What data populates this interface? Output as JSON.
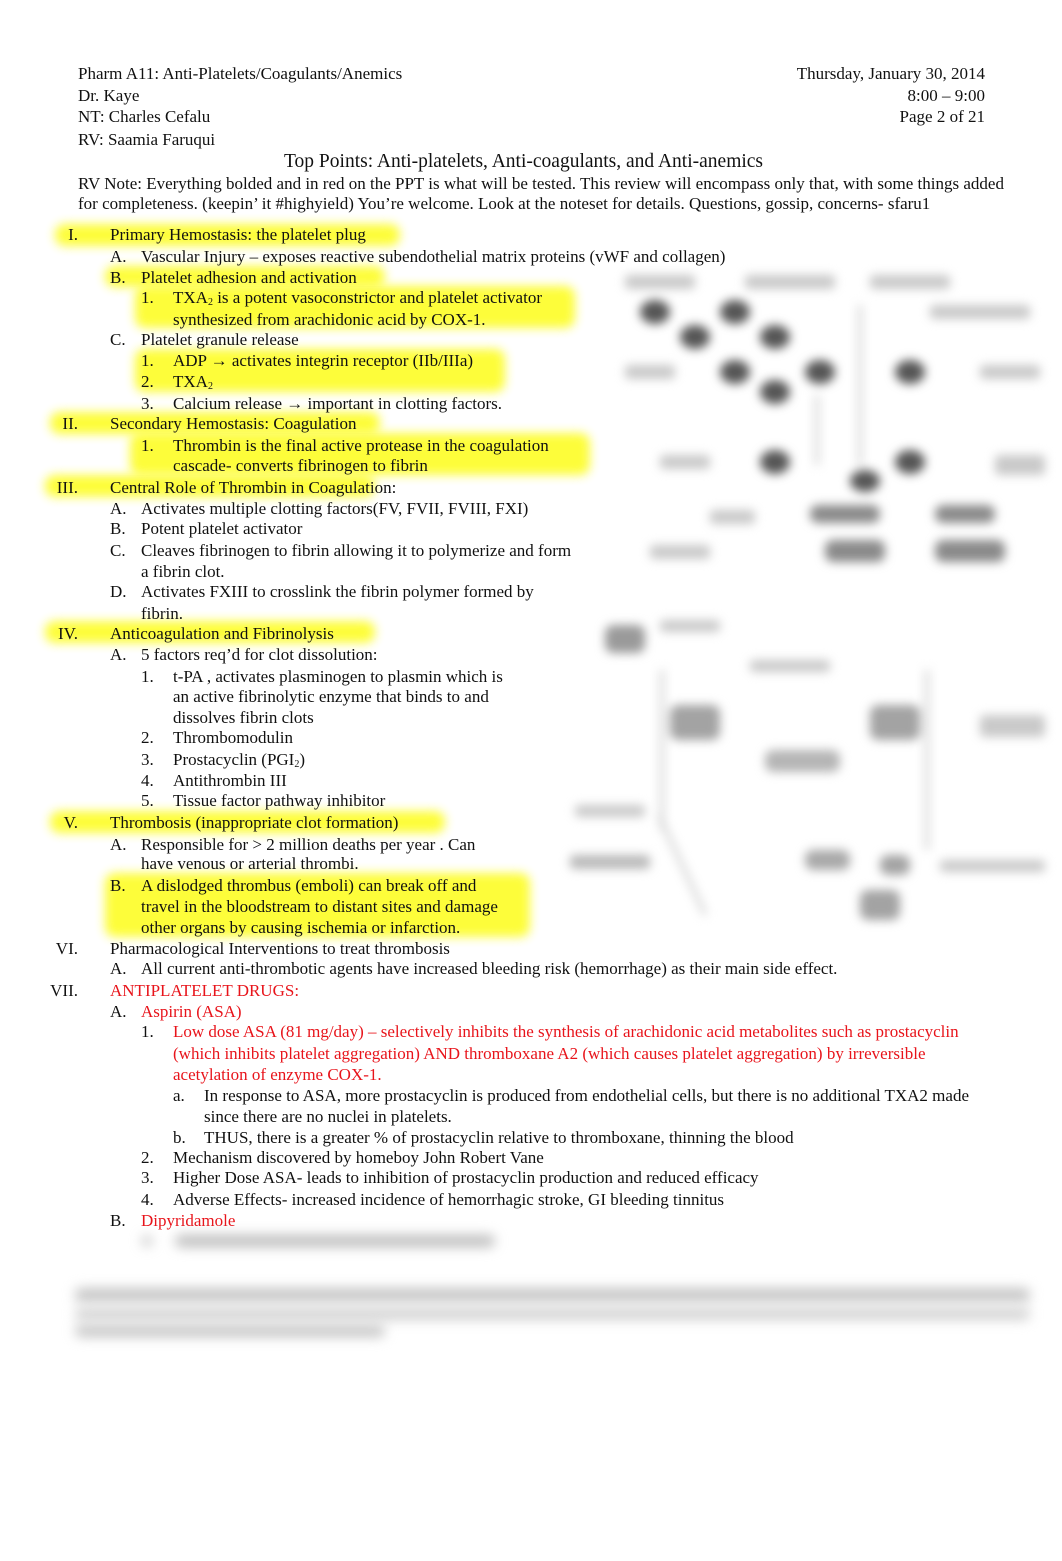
{
  "header": {
    "course": "Pharm A11: Anti-Platelets/Coagulants/Anemics",
    "lecturer": "Dr. Kaye",
    "note_taker": "NT:  Charles Cefalu",
    "reviewer": "RV:  Saamia Faruqui",
    "date": "Thursday, January 30, 2014",
    "time": "8:00 – 9:00",
    "page": "Page 2 of 21"
  },
  "title": "Top Points: Anti-platelets, Anti-coagulants, and Anti-anemics",
  "rv_note": {
    "line1": "RV Note: Everything bolded and in red on the PPT is what will be tested. This review will encompass only that, with some things added",
    "line2": "for completeness. (keepin’ it #highyield) You’re welcome. Look at the noteset for details. Questions, gossip, concerns- sfaru1"
  },
  "highlight_color": "#ffff00",
  "red_color": "#e8141b",
  "outline": {
    "s1": {
      "num": "I.",
      "text": "Primary Hemostasis:    the platelet plug",
      "a": {
        "num": "A.",
        "text": " Vascular Injury   – exposes reactive subendothelial matrix proteins (vWF and collagen)"
      },
      "b": {
        "num": "B.",
        "text": "Platelet adhesion and activation",
        "i1": {
          "num": "1.",
          "pre": "TXA",
          "sub": "2",
          "post": " is a potent vasoconstrictor and platelet activator",
          "line2": "synthesized from arachidonic acid by COX-1."
        }
      },
      "c": {
        "num": "C.",
        "text": "Platelet granule release",
        "i1": {
          "num": "1.",
          "text": "ADP → activates integrin receptor (IIb/IIIa)"
        },
        "i2": {
          "num": "2.",
          "pre": "TXA",
          "sub": "2"
        },
        "i3": {
          "num": "3.",
          "text": "Calcium release → important in clotting factors."
        }
      }
    },
    "s2": {
      "num": "II.",
      "text": "Secondary Hemostasis: Coagulation",
      "i1": {
        "num": "1.",
        "line1": "Thrombin is the final active protease in the coagulation",
        "line2": "cascade- converts fibrinogen to fibrin"
      }
    },
    "s3": {
      "num": "III.",
      "text": "Central Role of Thrombin  in Coagulation:",
      "a": {
        "num": "A.",
        "text": "Activates multiple clotting factors(FV, FVII, FVIII, FXI)"
      },
      "b": {
        "num": "B.",
        "text": "Potent platelet activator"
      },
      "c": {
        "num": "C.",
        "line1": "Cleaves fibrinogen to fibrin allowing it to polymerize and form",
        "line2": "a fibrin clot."
      },
      "d": {
        "num": "D.",
        "line1": "Activates FXIII to crosslink the fibrin polymer formed by",
        "line2": "fibrin."
      }
    },
    "s4": {
      "num": "IV.",
      "text": "Anticoagulation and Fibrinolysis",
      "a": {
        "num": "A.",
        "text": "5 factors req’d for clot dissolution:",
        "i1": {
          "num": "1.",
          "line1": "t-PA , activates plasminogen to plasmin which is",
          "line2": "an active fibrinolytic enzyme that binds to and",
          "line3": "dissolves fibrin clots"
        },
        "i2": {
          "num": "2.",
          "text": "Thrombomodulin"
        },
        "i3": {
          "num": "3.",
          "pre": "Prostacyclin (PGI",
          "sub": "2",
          "post": ")"
        },
        "i4": {
          "num": "4.",
          "text": "Antithrombin III"
        },
        "i5": {
          "num": "5.",
          "text": "Tissue factor pathway inhibitor"
        }
      }
    },
    "s5": {
      "num": "V.",
      "text": "Thrombosis (inappropriate clot formation)",
      "a": {
        "num": "A.",
        "line1": "Responsible for > 2 million deaths per year . Can",
        "line2": "have venous or arterial thrombi."
      },
      "b": {
        "num": "B.",
        "line1": "A dislodged thrombus (emboli) can break off and",
        "line2": "travel in the bloodstream to distant sites and damage",
        "line3": "other organs by causing ischemia or infarction."
      }
    },
    "s6": {
      "num": "VI.",
      "text": "Pharmacological Interventions     to treat thrombosis",
      "a": {
        "num": "A.",
        "text": "All current anti-thrombotic agents have increased bleeding risk    (hemorrhage) as their main side effect."
      }
    },
    "s7": {
      "num": "VII.",
      "text": "ANTIPLATELET DRUGS:",
      "a": {
        "num": "A.",
        "text": "Aspirin (ASA)",
        "i1": {
          "num": "1.",
          "line1": "Low dose ASA (81 mg/day) – selectively inhibits the synthesis of arachidonic acid    metabolites such as prostacyclin",
          "line2": "(which inhibits platelet aggregation) AND thromboxane A2  (which causes platelet aggregation) by irreversible",
          "line3": "acetylation of enzyme COX-1.",
          "ia": {
            "num": "a.",
            "line1": "In response to ASA, more prostacyclin is produced from endothelial cells, but there is no additional TXA2 made",
            "line2": "since there are no nuclei in platelets."
          },
          "ib": {
            "num": "b.",
            "text": "THUS, there is a greater % of prostacyclin relative to thromboxane, thinning the blood"
          }
        },
        "i2": {
          "num": "2.",
          "text": "Mechanism discovered by homeboy John Robert Vane"
        },
        "i3": {
          "num": "3.",
          "text": "Higher Dose ASA- leads to inhibition of prostacyclin production and reduced efficacy"
        },
        "i4": {
          "num": "4.",
          "text": "Adverse Effects- increased incidence of hemorrhagic stroke, GI bleeding tinnitus"
        }
      },
      "b": {
        "num": "B.",
        "text": "Dipyridamole"
      }
    }
  }
}
